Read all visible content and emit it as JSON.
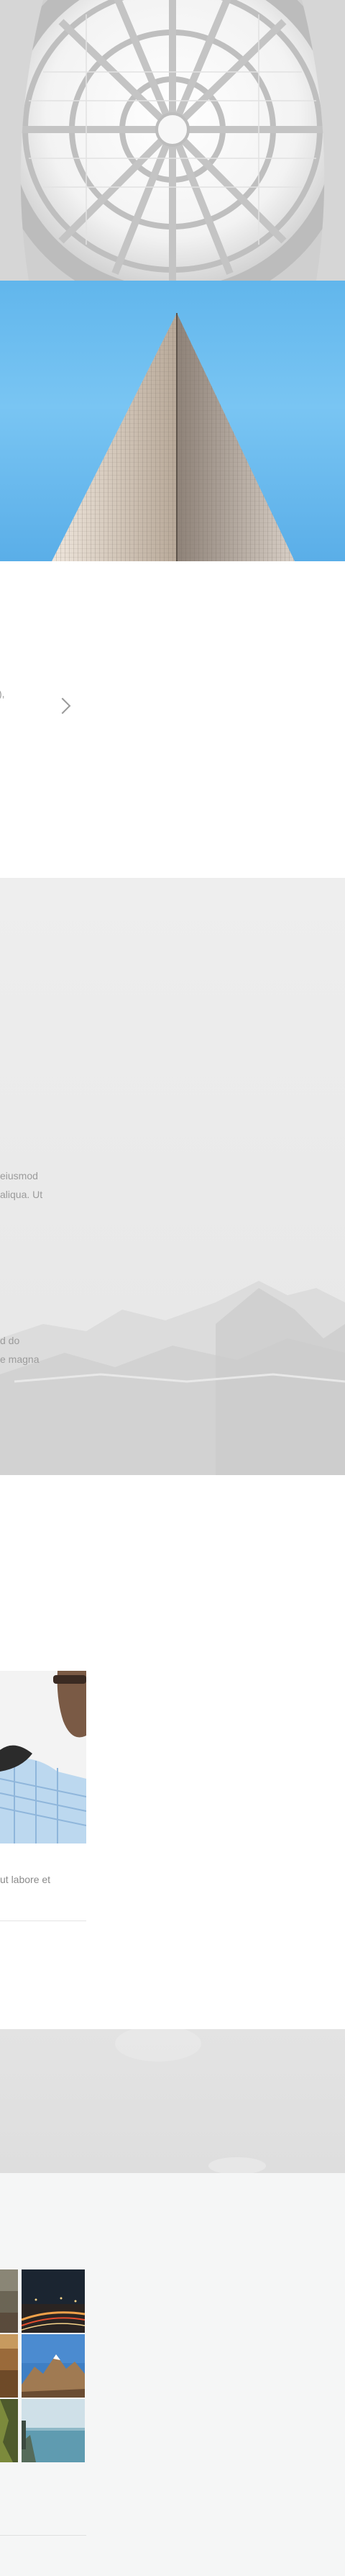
{
  "slider": {
    "fragment_text": "),",
    "next_arrow_icon": "chevron-right-icon"
  },
  "fog_section": {
    "line_1": "eiusmod",
    "line_2": "aliqua. Ut",
    "line_3": "d do",
    "line_4": "e magna"
  },
  "about": {
    "text": "ut labore et"
  },
  "colors": {
    "sky": "#61b6ec",
    "fog": "#eeeeee",
    "gallery_bg": "#f5f6f6",
    "muted_text": "#8c8c8c"
  }
}
